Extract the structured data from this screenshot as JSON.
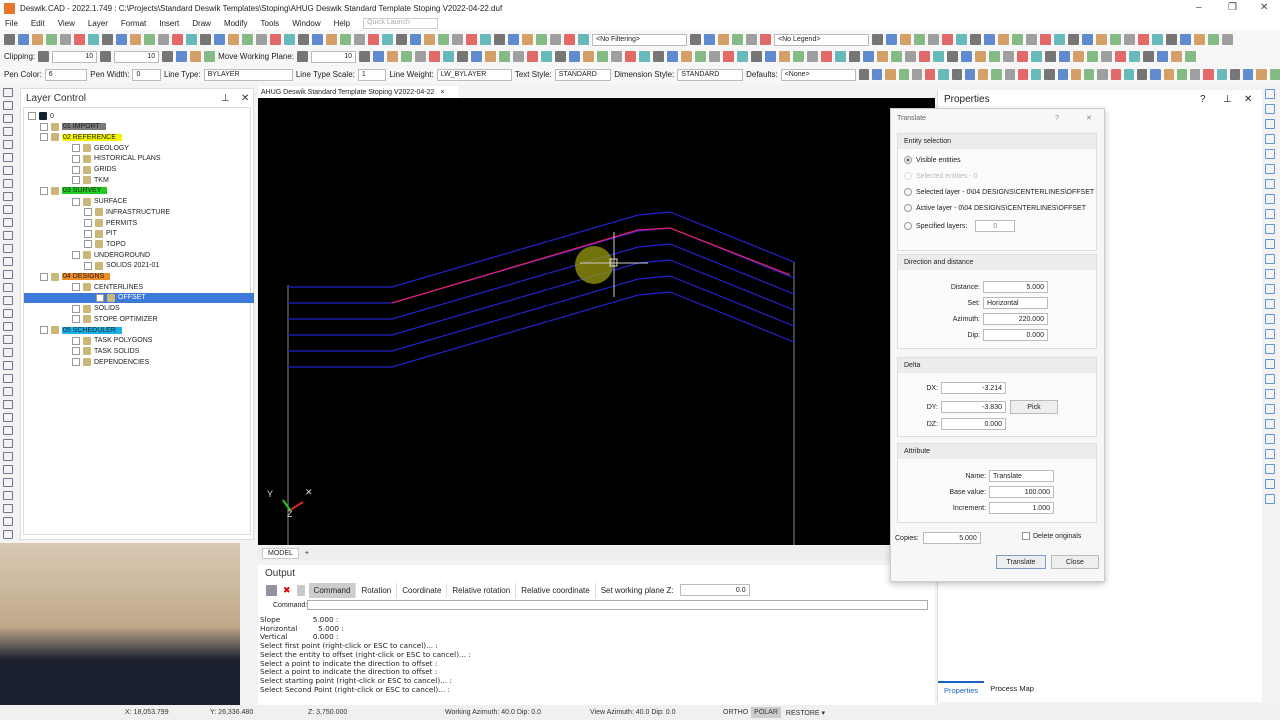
{
  "window": {
    "title": "Deswik.CAD - 2022.1.749 : C:\\Projects\\Standard Deswik Templates\\Stoping\\AHUG Deswik Standard Template Stoping V2022-04-22.duf",
    "minimize": "–",
    "maximize": "❐",
    "close": "✕"
  },
  "menu": [
    "File",
    "Edit",
    "View",
    "Layer",
    "Format",
    "Insert",
    "Draw",
    "Modify",
    "Tools",
    "Window",
    "Help"
  ],
  "quick_launch_placeholder": "Quick Launch",
  "toolbar1": {
    "filter": "<No Filtering>",
    "legend": "<No Legend>"
  },
  "toolbar2": {
    "clipping_label": "Clipping:",
    "clip1": "10",
    "clip2": "10",
    "move_plane_label": "Move Working Plane:",
    "plane_value": "10"
  },
  "toolbar3": {
    "pen_color_label": "Pen Color:",
    "pen_color": "6",
    "pen_width_label": "Pen Width:",
    "pen_width": "0",
    "line_type_label": "Line Type:",
    "line_type": "BYLAYER",
    "line_type_scale_label": "Line Type Scale:",
    "line_type_scale": "1",
    "line_weight_label": "Line Weight:",
    "line_weight": "LW_BYLAYER",
    "text_style_label": "Text Style:",
    "text_style": "STANDARD",
    "dim_style_label": "Dimension Style:",
    "dim_style": "STANDARD",
    "defaults_label": "Defaults:",
    "defaults": "<None>"
  },
  "layer_control": {
    "title": "Layer Control",
    "pin": "⊥",
    "close": "✕",
    "nodes": [
      {
        "label": "0",
        "depth": 0,
        "color": "#fff"
      },
      {
        "label": "01 IMPORT",
        "depth": 1,
        "color": "#7a7a7a"
      },
      {
        "label": "02 REFERENCE",
        "depth": 1,
        "color": "#f5f500"
      },
      {
        "label": "GEOLOGY",
        "depth": 2,
        "color": ""
      },
      {
        "label": "HISTORICAL PLANS",
        "depth": 2,
        "color": ""
      },
      {
        "label": "GRIDS",
        "depth": 2,
        "color": ""
      },
      {
        "label": "TKM",
        "depth": 2,
        "color": ""
      },
      {
        "label": "03 SURVEY",
        "depth": 1,
        "color": "#1fcc1f"
      },
      {
        "label": "SURFACE",
        "depth": 2,
        "color": ""
      },
      {
        "label": "INFRASTRUCTURE",
        "depth": 3,
        "color": ""
      },
      {
        "label": "PERMITS",
        "depth": 3,
        "color": ""
      },
      {
        "label": "PIT",
        "depth": 3,
        "color": ""
      },
      {
        "label": "TOPO",
        "depth": 3,
        "color": ""
      },
      {
        "label": "UNDERGROUND",
        "depth": 2,
        "color": ""
      },
      {
        "label": "SOLIDS 2021-01",
        "depth": 3,
        "color": ""
      },
      {
        "label": "04 DESIGNS",
        "depth": 1,
        "color": "#f08a24"
      },
      {
        "label": "CENTERLINES",
        "depth": 2,
        "color": ""
      },
      {
        "label": "OFFSET",
        "depth": 3,
        "color": "selected"
      },
      {
        "label": "SOLIDS",
        "depth": 2,
        "color": ""
      },
      {
        "label": "STOPE OPTIMIZER",
        "depth": 2,
        "color": ""
      },
      {
        "label": "05 SCHEDULER",
        "depth": 1,
        "color": "#1ab0e8"
      },
      {
        "label": "TASK POLYGONS",
        "depth": 2,
        "color": ""
      },
      {
        "label": "TASK SOLIDS",
        "depth": 2,
        "color": ""
      },
      {
        "label": "DEPENDENCIES",
        "depth": 2,
        "color": ""
      }
    ]
  },
  "viewport": {
    "tab": "AHUG Deswik Standard Template Stoping V2022-04-22",
    "tab_close": "×",
    "model_tab": "MODEL",
    "add_tab": "+",
    "axis_y": "Y",
    "axis_z": "Z",
    "axis_x": "✕",
    "colors": {
      "line": "#2222cc",
      "selected": "#e0206a",
      "vertical": "#888888"
    }
  },
  "properties": {
    "title": "Properties",
    "help": "?",
    "pin": "⊥",
    "close": "✕",
    "tabs": [
      "Properties",
      "Process Map"
    ]
  },
  "translate": {
    "title": "Translate",
    "help": "?",
    "close": "✕",
    "entity_selection": {
      "header": "Entity selection",
      "visible": "Visible entities",
      "selected_entities": "Selected entities - 0",
      "selected_layer": "Selected layer  - 0\\04 DESIGNS\\CENTERLINES\\OFFSET",
      "active_layer": "Active layer  - 0\\04 DESIGNS\\CENTERLINES\\OFFSET",
      "specified": "Specified layers:",
      "specified_value": "0"
    },
    "direction": {
      "header": "Direction and distance",
      "distance_label": "Distance:",
      "distance": "5.000",
      "set_label": "Set:",
      "set": "Horizontal",
      "azimuth_label": "Azimuth:",
      "azimuth": "220.000",
      "dip_label": "Dip:",
      "dip": "0.000"
    },
    "delta": {
      "header": "Delta",
      "dx_label": "DX:",
      "dx": "-3.214",
      "dy_label": "DY:",
      "dy": "-3.830",
      "dz_label": "DZ:",
      "dz": "0.000",
      "pick": "Pick"
    },
    "attribute": {
      "header": "Attribute",
      "name_label": "Name:",
      "name": "Translate",
      "base_label": "Base value:",
      "base": "100.000",
      "inc_label": "Increment:",
      "inc": "1.000"
    },
    "copies_label": "Copies:",
    "copies": "5.000",
    "delete_originals": "Delete originals",
    "translate_btn": "Translate",
    "close_btn": "Close"
  },
  "output": {
    "title": "Output",
    "tabs": [
      "Command",
      "Rotation",
      "Coordinate",
      "Relative rotation",
      "Relative coordinate"
    ],
    "wp_label": "Set working plane Z:",
    "wp_value": "0.0",
    "command_label": "Command:",
    "log": [
      "Slope              5.000 :",
      "Horizontal         5.000 :",
      "Vertical           0.000 :",
      "Select first point (right-click or ESC to cancel)... :",
      "Select the entity to offset (right-click or ESC to cancel)... :",
      "Select a point to indicate the direction to offset :",
      "Select a point to indicate the direction to offset :",
      "Select starting point (right-click or ESC to cancel)... :",
      "Select Second Point (right-click or ESC to cancel)... :"
    ]
  },
  "status": {
    "x": "X: 18,053.799",
    "y": "Y: 26,336.480",
    "z": "Z: 3,750.000",
    "working": "Working Azimuth: 40.0 Dip: 0.0",
    "view": "View Azimuth: 40.0 Dip: 0.0",
    "ortho": "ORTHO",
    "polar": "POLAR",
    "restore": "RESTORE ▾"
  }
}
